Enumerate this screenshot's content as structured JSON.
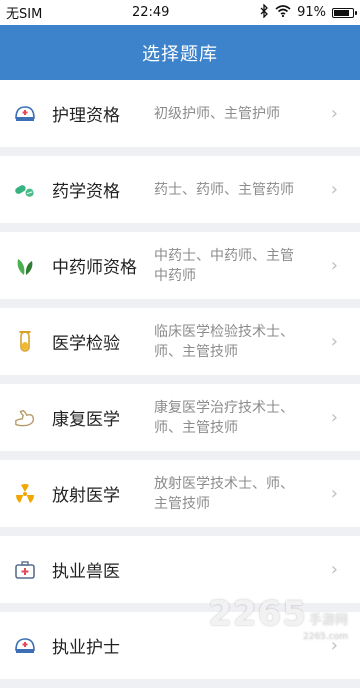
{
  "status": {
    "carrier": "无SIM",
    "time": "22:49",
    "battery": "91%",
    "battery_level": 0.91
  },
  "header": {
    "title": "选择题库"
  },
  "items": [
    {
      "name": "护理资格",
      "desc": "初级护师、主管护师",
      "icon": "nurse-cap-icon"
    },
    {
      "name": "药学资格",
      "desc": "药士、药师、主管药师",
      "icon": "pill-capsule-icon"
    },
    {
      "name": "中药师资格",
      "desc": "中药士、中药师、主管中药师",
      "icon": "herb-leaves-icon"
    },
    {
      "name": "医学检验",
      "desc": "临床医学检验技术士、师、主管技师",
      "icon": "test-tube-icon"
    },
    {
      "name": "康复医学",
      "desc": "康复医学治疗技术士、师、主管技师",
      "icon": "muscle-arm-icon"
    },
    {
      "name": "放射医学",
      "desc": "放射医学技术士、师、主管技师",
      "icon": "radiation-icon"
    },
    {
      "name": "执业兽医",
      "desc": "",
      "icon": "medical-kit-icon"
    },
    {
      "name": "执业护士",
      "desc": "",
      "icon": "nurse-cap-icon"
    }
  ],
  "watermark": {
    "big": "2265",
    "small": "手游网",
    "url": "2265.com"
  },
  "colors": {
    "header": "#3c83cc",
    "background": "#eef0f4"
  }
}
